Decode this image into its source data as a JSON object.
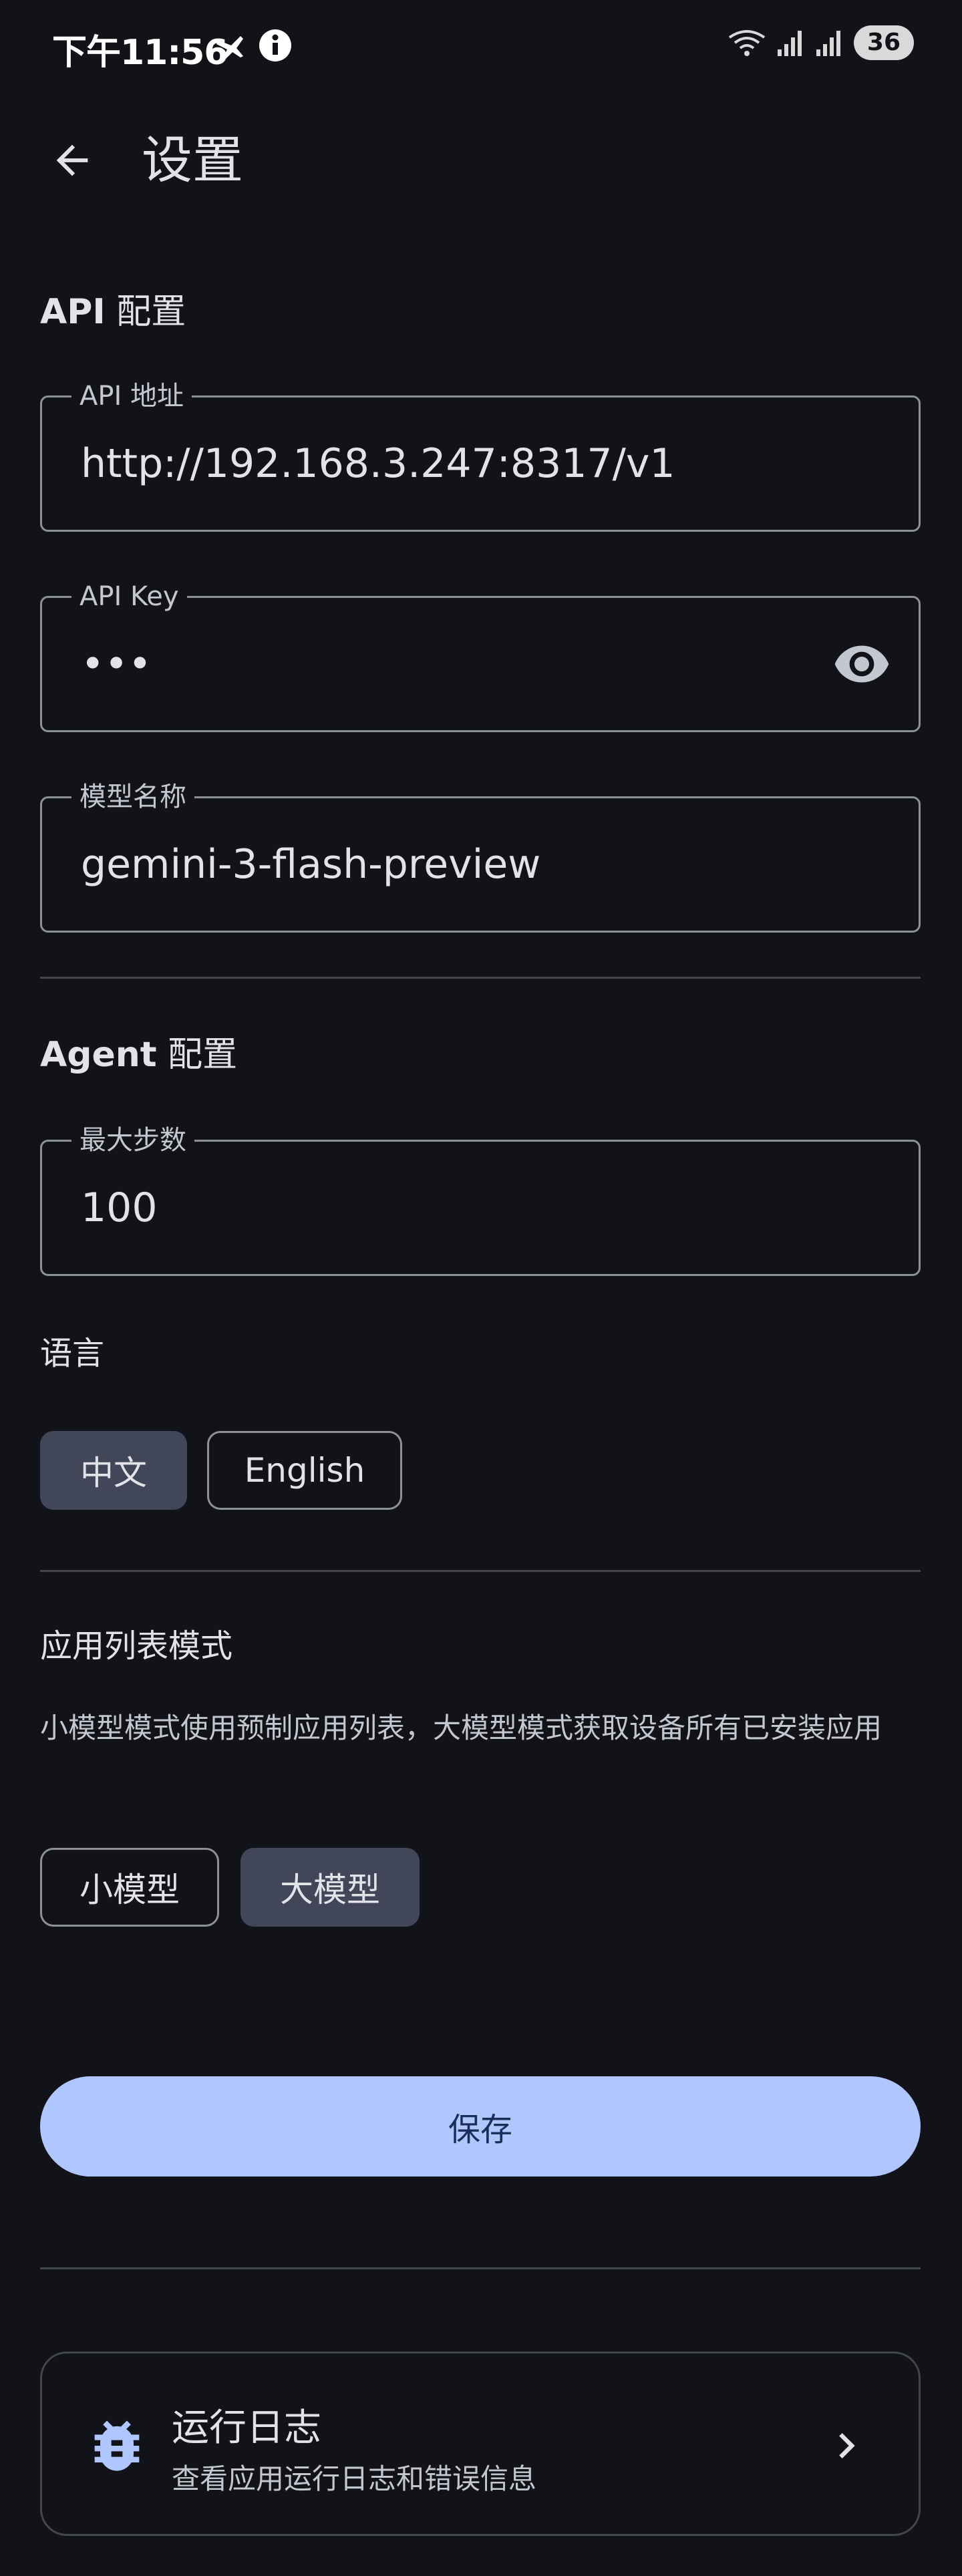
{
  "status_bar": {
    "time": "下午11:56",
    "battery": "36",
    "icons": [
      "airplane-icon",
      "info-icon",
      "wifi-icon",
      "signal-icon",
      "signal-icon"
    ]
  },
  "app_bar": {
    "title": "设置",
    "back_icon": "arrow-back-icon"
  },
  "api_section": {
    "title_bold": "API",
    "title_rest": " 配置",
    "fields": {
      "url": {
        "label": "API 地址",
        "value": "http://192.168.3.247:8317/v1"
      },
      "key": {
        "label": "API Key",
        "value": "•••",
        "icon": "visibility-icon"
      },
      "model": {
        "label": "模型名称",
        "value": "gemini-3-flash-preview"
      }
    }
  },
  "agent_section": {
    "title_bold": "Agent",
    "title_rest": " 配置",
    "max_steps": {
      "label": "最大步数",
      "value": "100"
    },
    "language": {
      "label": "语言",
      "options": [
        "中文",
        "English"
      ],
      "selected": "中文"
    }
  },
  "app_list_section": {
    "title": "应用列表模式",
    "description": "小模型模式使用预制应用列表，大模型模式获取设备所有已安装应用",
    "options": [
      "小模型",
      "大模型"
    ],
    "selected": "大模型"
  },
  "save_button": {
    "label": "保存"
  },
  "log_entry": {
    "title": "运行日志",
    "subtitle": "查看应用运行日志和错误信息",
    "icon": "bug-icon"
  },
  "colors": {
    "background": "#121318",
    "primary": "#B0C6FF",
    "selected_chip": "#414659",
    "outline": "#8E9099"
  }
}
